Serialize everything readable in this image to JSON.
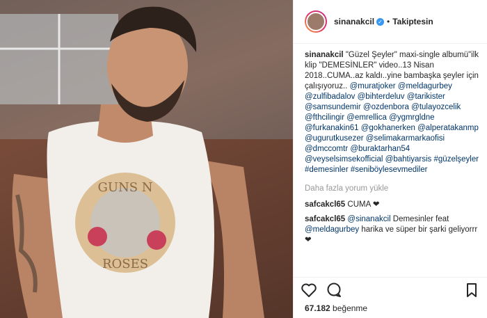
{
  "header": {
    "username": "sinanakcil",
    "verified_icon": "verified-badge-icon",
    "separator": "•",
    "follow_label": "Takiptesin"
  },
  "caption": {
    "username": "sinanakcil",
    "text": "\"Güzel Şeyler\" maxi-single albumü\"ilk klip \"DEMESİNLER\" video..13 Nisan 2018..CUMA..az kaldı..yine bambaşka şeyler için çalışıyoruz.. ",
    "mentions": [
      "@muratjoker",
      "@meldagurbey",
      "@zulfibadalov",
      "@bihterdeluv",
      "@tarikister",
      "@samsundemir",
      "@ozdenbora",
      "@tulayozcelik",
      "@fthcilingir",
      "@emrellica",
      "@ygmrgldne",
      "@furkanakin61",
      "@gokhanerken",
      "@alperatakanmp",
      "@ugurutkusezer",
      "@selimakarmarkaofisi",
      "@dmccomtr",
      "@buraktarhan54",
      "@veyselsimsekofficial",
      "@bahtiyarsis",
      "#güzelşeyler",
      "#demesinler",
      "#seniböylesevmediler"
    ]
  },
  "load_more": "Daha fazla yorum yükle",
  "comments": [
    {
      "username": "safcakcl65",
      "text": "CUMA ❤"
    },
    {
      "username": "safcakcl65",
      "mention": "@sinanakcil",
      "text": " Demesinler feat ",
      "mention2": "@meldagurbey",
      "text2": " harika ve süper bir şarki geliyorrr❤"
    }
  ],
  "actions": {
    "like_icon": "heart-outline-icon",
    "comment_icon": "comment-bubble-icon",
    "save_icon": "bookmark-icon"
  },
  "likes": {
    "count": "67.182",
    "label": "beğenme"
  },
  "photo": {
    "shirt_print_top": "GUNS N",
    "shirt_print_bottom": "ROSES"
  }
}
